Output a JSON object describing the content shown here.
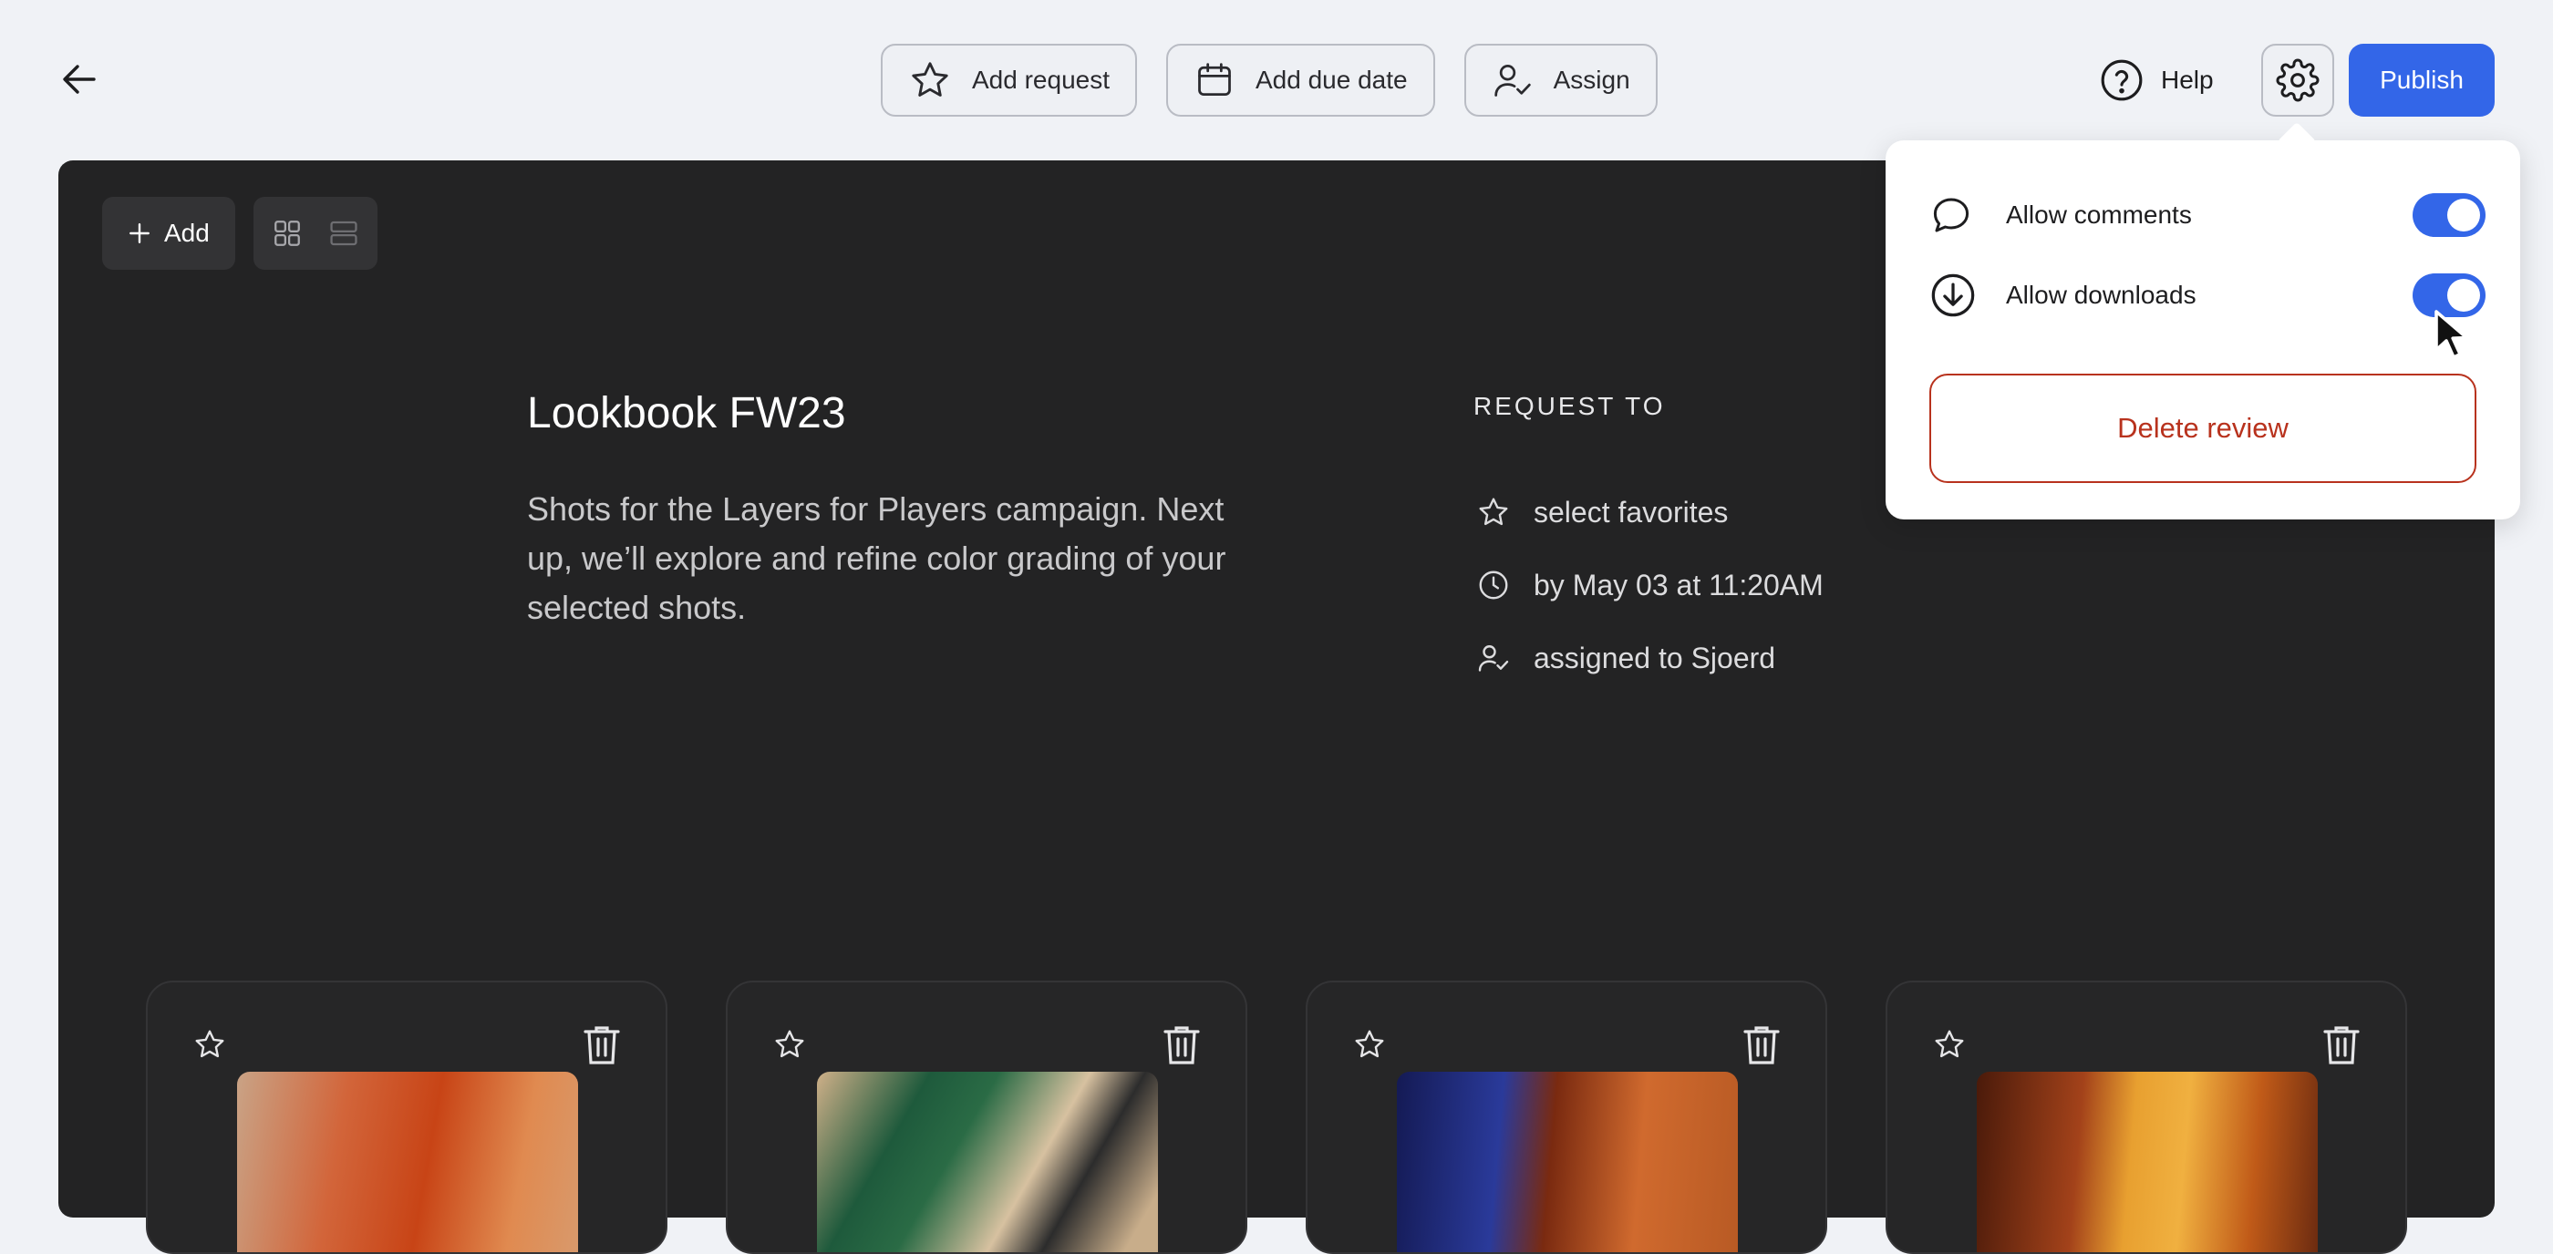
{
  "header": {
    "back_icon": "arrow-left-icon",
    "actions": [
      {
        "label": "Add request",
        "icon": "star-icon"
      },
      {
        "label": "Add due date",
        "icon": "calendar-icon"
      },
      {
        "label": "Assign",
        "icon": "user-check-icon"
      }
    ],
    "help_label": "Help",
    "settings_icon": "gear-icon",
    "publish_label": "Publish",
    "publish_color": "#3366e8"
  },
  "canvas": {
    "add_label": "Add",
    "view_modes": [
      "grid-view-icon",
      "list-view-icon"
    ],
    "title": "Lookbook FW23",
    "description": "Shots for the Layers for Players campaign. Next up, we’ll explore and refine color grading of your selected shots.",
    "request_heading": "REQUEST TO",
    "request_items": [
      {
        "icon": "star-icon",
        "text": "select favorites"
      },
      {
        "icon": "clock-icon",
        "text": "by May 03 at 11:20AM"
      },
      {
        "icon": "user-check-icon",
        "text": "assigned to Sjoerd"
      }
    ],
    "cards": [
      {
        "favorite": false
      },
      {
        "favorite": false
      },
      {
        "favorite": false
      },
      {
        "favorite": false
      }
    ]
  },
  "settings_popover": {
    "options": [
      {
        "label": "Allow comments",
        "icon": "comment-icon",
        "enabled": true
      },
      {
        "label": "Allow downloads",
        "icon": "download-icon",
        "enabled": true
      }
    ],
    "delete_label": "Delete review",
    "delete_color": "#b8321d"
  }
}
